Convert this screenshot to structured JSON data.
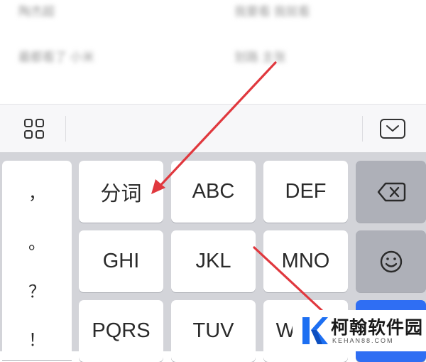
{
  "content": {
    "lines": [
      {
        "text": "陶杰超",
        "col": "left",
        "row": 0
      },
      {
        "text": "我要看 我就看",
        "col": "right",
        "row": 0
      },
      {
        "text": "最都看了 小米",
        "col": "left",
        "row": 1
      },
      {
        "text": "划路 主张",
        "col": "right",
        "row": 1
      }
    ]
  },
  "toolbar": {
    "left_icon": "grid-icon",
    "right_icon": "keyboard-hide-icon"
  },
  "keyboard": {
    "punctuation": [
      "，",
      "。",
      "？",
      "！"
    ],
    "rows": [
      [
        {
          "label": "分词",
          "name": "key-segment"
        },
        {
          "label": "ABC",
          "name": "key-abc"
        },
        {
          "label": "DEF",
          "name": "key-def"
        }
      ],
      [
        {
          "label": "GHI",
          "name": "key-ghi"
        },
        {
          "label": "JKL",
          "name": "key-jkl"
        },
        {
          "label": "MNO",
          "name": "key-mno"
        }
      ],
      [
        {
          "label": "PQRS",
          "name": "key-pqrs"
        },
        {
          "label": "TUV",
          "name": "key-tuv"
        },
        {
          "label": "WXYZ",
          "name": "key-wxyz"
        }
      ]
    ],
    "backspace_icon": "backspace-icon",
    "emoji_icon": "emoji-icon",
    "accent_color": "#2f6ef3"
  },
  "annotations": {
    "arrow_color": "#e0383e"
  },
  "watermark": {
    "title": "柯翰软件园",
    "subtitle": "KEHAN88.COM",
    "logo_icon": "k-logo-icon"
  }
}
